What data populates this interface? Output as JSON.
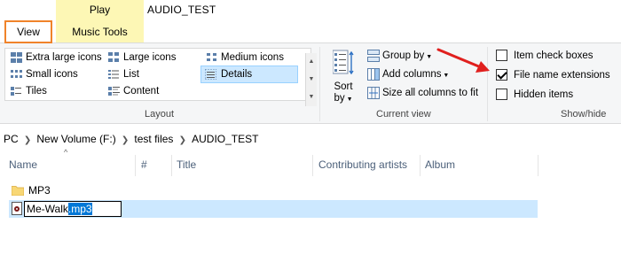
{
  "tabs": {
    "play_label": "Play",
    "music_tools_label": "Music Tools",
    "view_label": "View",
    "window_title": "AUDIO_TEST"
  },
  "layout_group": {
    "label": "Layout",
    "items": [
      {
        "label": "Extra large icons",
        "icon": "extra-large-icons-icon"
      },
      {
        "label": "Large icons",
        "icon": "large-icons-icon"
      },
      {
        "label": "Medium icons",
        "icon": "medium-icons-icon"
      },
      {
        "label": "Small icons",
        "icon": "small-icons-icon"
      },
      {
        "label": "List",
        "icon": "list-icon"
      },
      {
        "label": "Details",
        "icon": "details-icon",
        "selected": true
      },
      {
        "label": "Tiles",
        "icon": "tiles-icon"
      },
      {
        "label": "Content",
        "icon": "content-icon"
      }
    ]
  },
  "current_view_group": {
    "label": "Current view",
    "sort_by_label_1": "Sort",
    "sort_by_label_2": "by",
    "group_by": "Group by",
    "add_columns": "Add columns",
    "size_all_columns": "Size all columns to fit"
  },
  "show_hide_group": {
    "label": "Show/hide",
    "item_check_boxes": {
      "label": "Item check boxes",
      "checked": false
    },
    "file_name_extensions": {
      "label": "File name extensions",
      "checked": true
    },
    "hidden_items": {
      "label": "Hidden items",
      "checked": false
    }
  },
  "address": {
    "crumbs": [
      "PC",
      "New Volume (F:)",
      "test files",
      "AUDIO_TEST"
    ]
  },
  "columns": {
    "name": "Name",
    "number": "#",
    "title": "Title",
    "contributing_artists": "Contributing artists",
    "album": "Album"
  },
  "files": [
    {
      "name": "MP3",
      "type": "folder"
    },
    {
      "name_base": "Me-Walk",
      "name_ext": ".mp3",
      "type": "audio",
      "renaming": true
    }
  ],
  "colors": {
    "accent_highlight": "#f0832a",
    "music_tools_tab": "#fdf7b5",
    "selection": "#cce8ff",
    "text_selection": "#0078d7",
    "annotation_arrow": "#e0201e"
  }
}
